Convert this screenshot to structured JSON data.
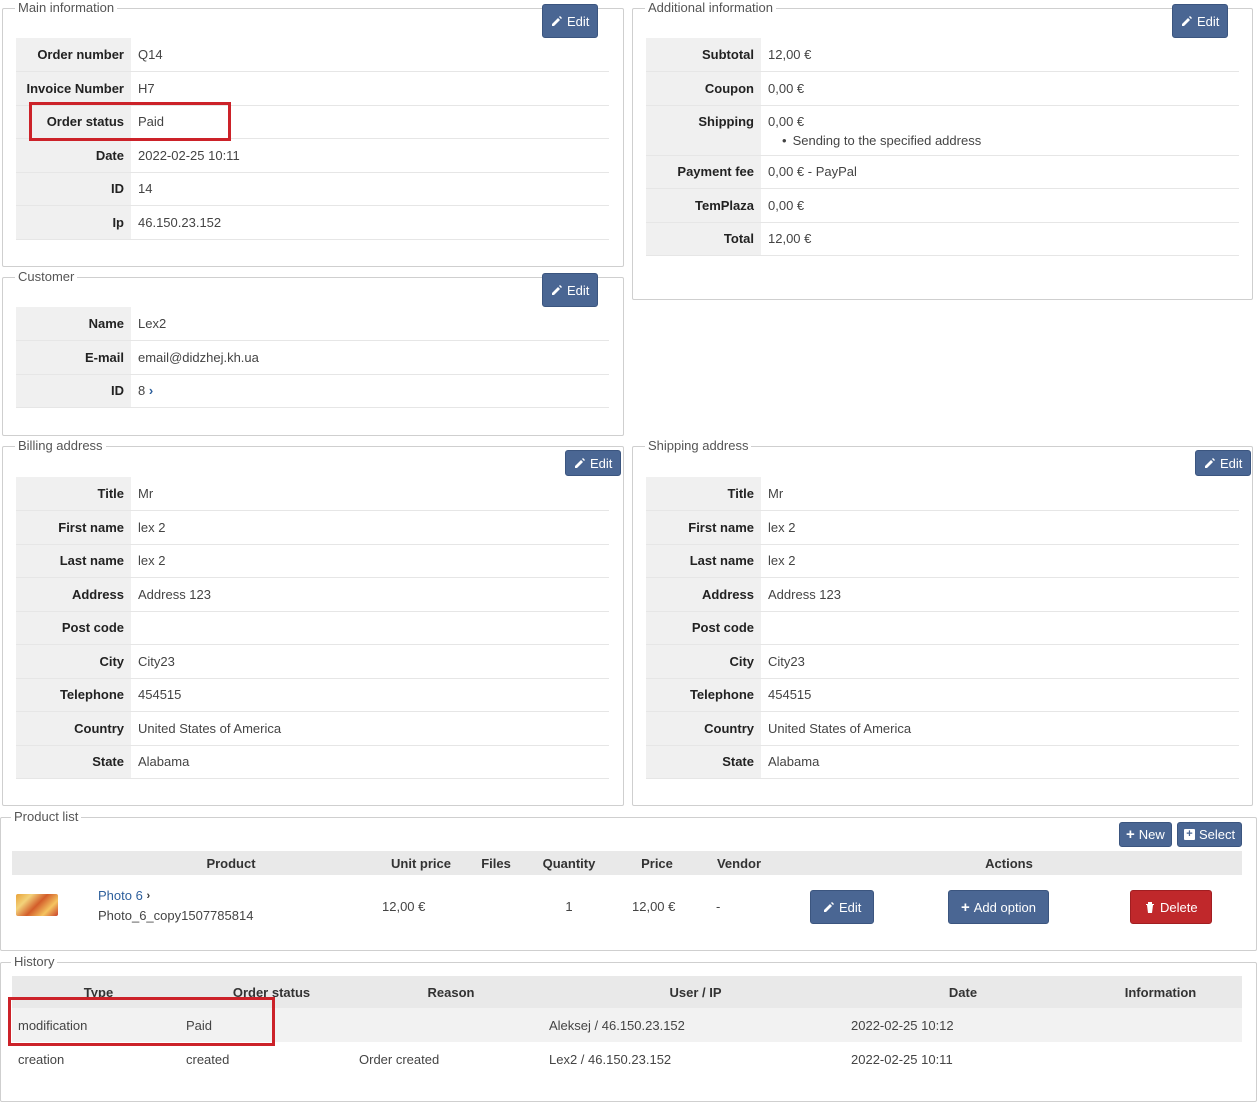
{
  "main_info": {
    "legend": "Main information",
    "edit": "Edit",
    "rows": [
      {
        "k": "Order number",
        "v": "Q14"
      },
      {
        "k": "Invoice Number",
        "v": "H7"
      },
      {
        "k": "Order status",
        "v": "Paid"
      },
      {
        "k": "Date",
        "v": "2022-02-25 10:11"
      },
      {
        "k": "ID",
        "v": "14"
      },
      {
        "k": "Ip",
        "v": "46.150.23.152"
      }
    ]
  },
  "additional_info": {
    "legend": "Additional information",
    "edit": "Edit",
    "subtotal_label": "Subtotal",
    "subtotal": "12,00 €",
    "coupon_label": "Coupon",
    "coupon": "0,00 €",
    "shipping_label": "Shipping",
    "shipping": "0,00 €",
    "shipping_note": "Sending to the specified address",
    "payment_label": "Payment fee",
    "payment": "0,00 € - PayPal",
    "templaza_label": "TemPlaza",
    "templaza": "0,00 €",
    "total_label": "Total",
    "total": "12,00 €"
  },
  "customer": {
    "legend": "Customer",
    "edit": "Edit",
    "name_label": "Name",
    "name": "Lex2",
    "email_label": "E-mail",
    "email": "email@didzhej.kh.ua",
    "id_label": "ID",
    "id": "8"
  },
  "billing": {
    "legend": "Billing address",
    "edit": "Edit",
    "rows": [
      {
        "k": "Title",
        "v": "Mr"
      },
      {
        "k": "First name",
        "v": "lex 2"
      },
      {
        "k": "Last name",
        "v": "lex 2"
      },
      {
        "k": "Address",
        "v": "Address 123"
      },
      {
        "k": "Post code",
        "v": ""
      },
      {
        "k": "City",
        "v": "City23"
      },
      {
        "k": "Telephone",
        "v": "454515"
      },
      {
        "k": "Country",
        "v": "United States of America"
      },
      {
        "k": "State",
        "v": "Alabama"
      }
    ]
  },
  "shipping": {
    "legend": "Shipping address",
    "edit": "Edit",
    "rows": [
      {
        "k": "Title",
        "v": "Mr"
      },
      {
        "k": "First name",
        "v": "lex 2"
      },
      {
        "k": "Last name",
        "v": "lex 2"
      },
      {
        "k": "Address",
        "v": "Address 123"
      },
      {
        "k": "Post code",
        "v": ""
      },
      {
        "k": "City",
        "v": "City23"
      },
      {
        "k": "Telephone",
        "v": "454515"
      },
      {
        "k": "Country",
        "v": "United States of America"
      },
      {
        "k": "State",
        "v": "Alabama"
      }
    ]
  },
  "products": {
    "legend": "Product list",
    "new_btn": "New",
    "select_btn": "Select",
    "headers": {
      "product": "Product",
      "unit_price": "Unit price",
      "files": "Files",
      "quantity": "Quantity",
      "price": "Price",
      "vendor": "Vendor",
      "actions": "Actions"
    },
    "item": {
      "name": "Photo 6",
      "code": "Photo_6_copy1507785814",
      "unit_price": "12,00 €",
      "files": "",
      "quantity": "1",
      "price": "12,00 €",
      "vendor": "-",
      "edit": "Edit",
      "add_option": "Add option",
      "delete": "Delete"
    }
  },
  "history": {
    "legend": "History",
    "headers": {
      "type": "Type",
      "status": "Order status",
      "reason": "Reason",
      "user": "User / IP",
      "date": "Date",
      "info": "Information"
    },
    "rows": [
      {
        "type": "modification",
        "status": "Paid",
        "reason": "",
        "user": "Aleksej / 46.150.23.152",
        "date": "2022-02-25 10:12",
        "info": ""
      },
      {
        "type": "creation",
        "status": "created",
        "reason": "Order created",
        "user": "Lex2 / 46.150.23.152",
        "date": "2022-02-25 10:11",
        "info": ""
      }
    ]
  }
}
